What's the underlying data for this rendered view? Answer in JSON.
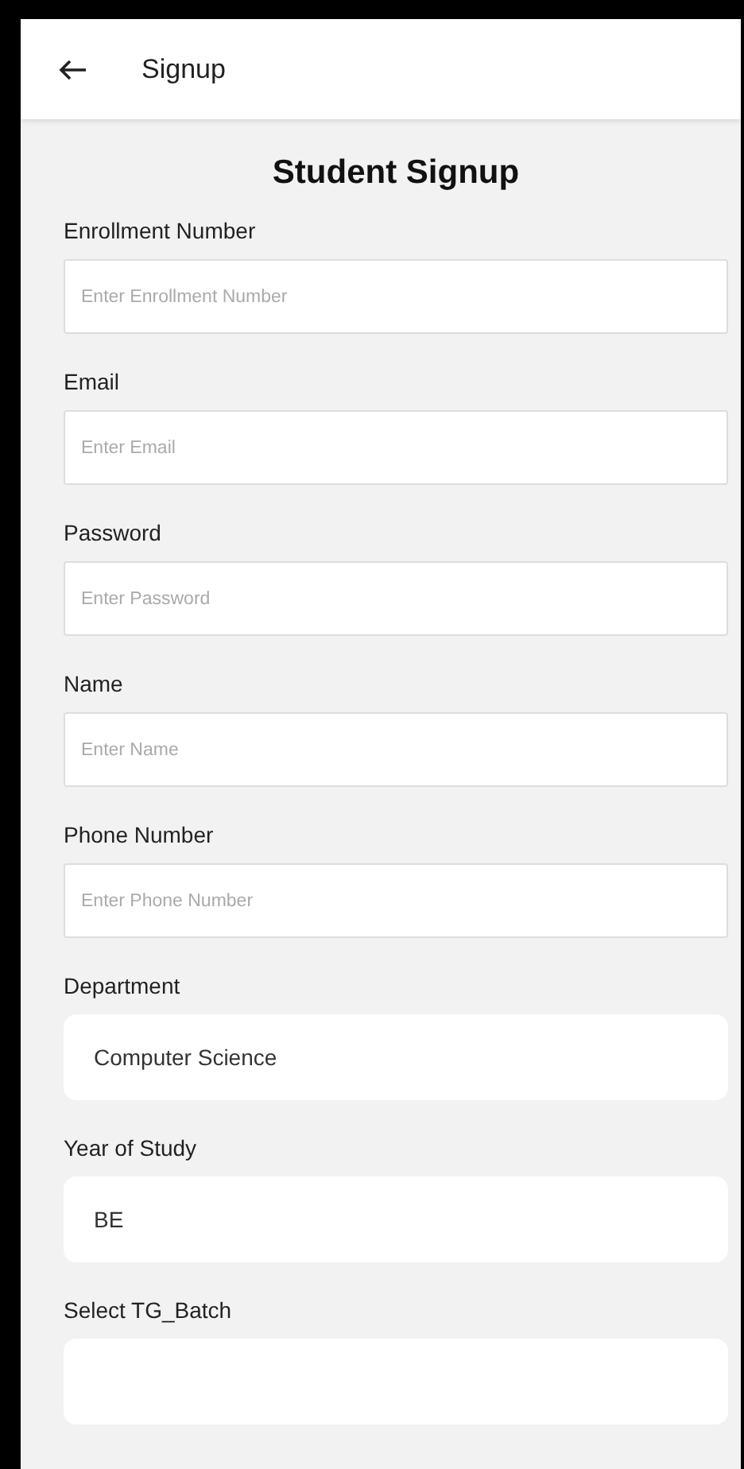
{
  "header": {
    "title": "Signup"
  },
  "form": {
    "title": "Student Signup",
    "fields": [
      {
        "kind": "input",
        "label": "Enrollment Number",
        "placeholder": "Enter Enrollment Number"
      },
      {
        "kind": "input",
        "label": "Email",
        "placeholder": "Enter Email"
      },
      {
        "kind": "input",
        "label": "Password",
        "placeholder": "Enter Password"
      },
      {
        "kind": "input",
        "label": "Name",
        "placeholder": "Enter Name"
      },
      {
        "kind": "input",
        "label": "Phone Number",
        "placeholder": "Enter Phone Number"
      },
      {
        "kind": "picker",
        "label": "Department",
        "value": "Computer Science"
      },
      {
        "kind": "picker",
        "label": "Year of Study",
        "value": "BE"
      },
      {
        "kind": "picker",
        "label": "Select TG_Batch"
      }
    ]
  }
}
